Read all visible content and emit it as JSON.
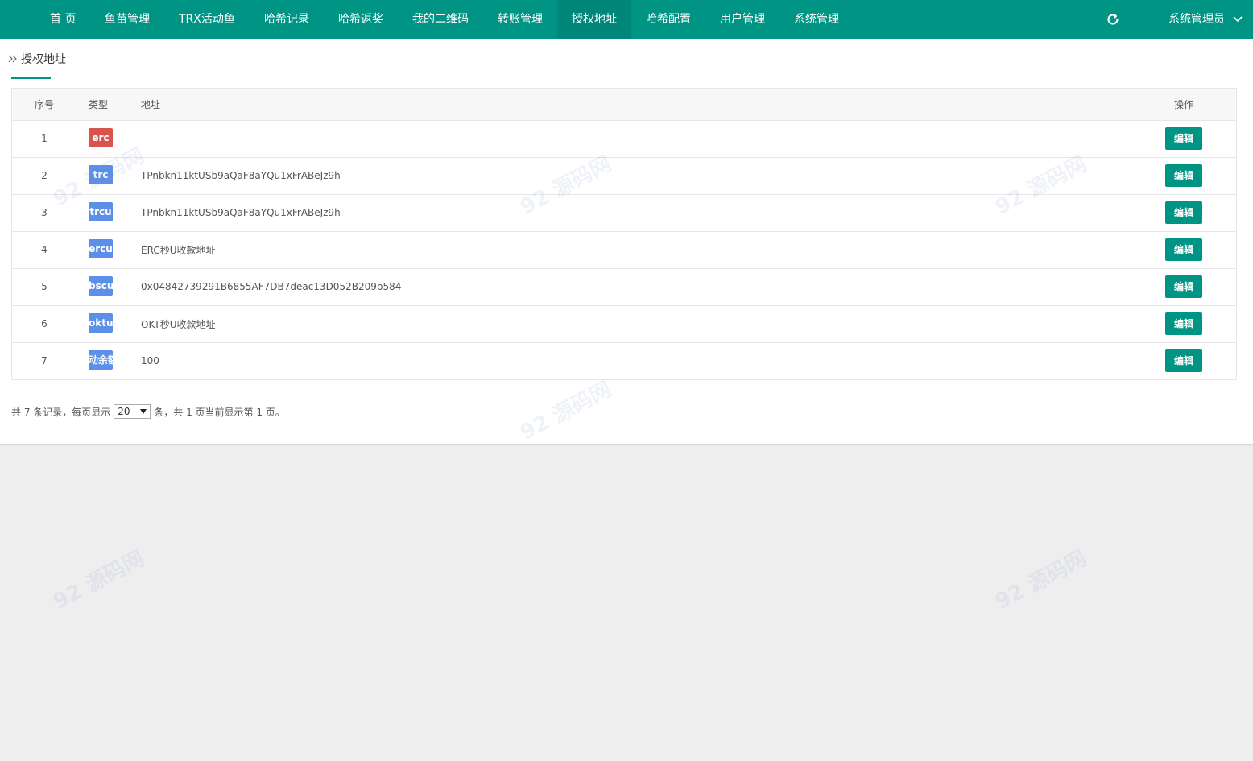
{
  "nav": {
    "items": [
      "首 页",
      "鱼苗管理",
      "TRX活动鱼",
      "哈希记录",
      "哈希返奖",
      "我的二维码",
      "转账管理",
      "授权地址",
      "哈希配置",
      "用户管理",
      "系统管理"
    ],
    "active_index": 7,
    "refresh_icon": "refresh-icon",
    "user_label": "系统管理员"
  },
  "breadcrumb": {
    "label": "授权地址"
  },
  "table": {
    "headers": {
      "index": "序号",
      "type": "类型",
      "address": "地址",
      "action": "操作"
    },
    "rows": [
      {
        "index": "1",
        "type": "erc",
        "type_color": "#d9534f",
        "address": "",
        "action": "编辑"
      },
      {
        "index": "2",
        "type": "trc",
        "type_color": "#5b8fe8",
        "address": "TPnbkn11ktUSb9aQaF8aYQu1xFrABeJz9h",
        "action": "编辑"
      },
      {
        "index": "3",
        "type": "trcu",
        "type_color": "#5b8fe8",
        "address": "TPnbkn11ktUSb9aQaF8aYQu1xFrABeJz9h",
        "action": "编辑"
      },
      {
        "index": "4",
        "type": "ercu",
        "type_color": "#5b8fe8",
        "address": "ERC秒U收款地址",
        "action": "编辑"
      },
      {
        "index": "5",
        "type": "bscu",
        "type_color": "#5b8fe8",
        "address": "0x04842739291B6855AF7DB7deac13D052B209b584",
        "action": "编辑"
      },
      {
        "index": "6",
        "type": "oktu",
        "type_color": "#5b8fe8",
        "address": "OKT秒U收款地址",
        "action": "编辑"
      },
      {
        "index": "7",
        "type": "动余额",
        "type_color": "#5b8fe8",
        "address": "100",
        "action": "编辑"
      }
    ]
  },
  "pager": {
    "prefix": "共 7 条记录，每页显示",
    "page_size": "20",
    "suffix": "条，共 1 页当前显示第 1 页。"
  },
  "watermark": {
    "text": "92 源码网",
    "url": "www.92luntan.com"
  },
  "colors": {
    "primary": "#009485",
    "primary_dark": "#00877a",
    "badge_red": "#d9534f",
    "badge_blue": "#5b8fe8"
  }
}
